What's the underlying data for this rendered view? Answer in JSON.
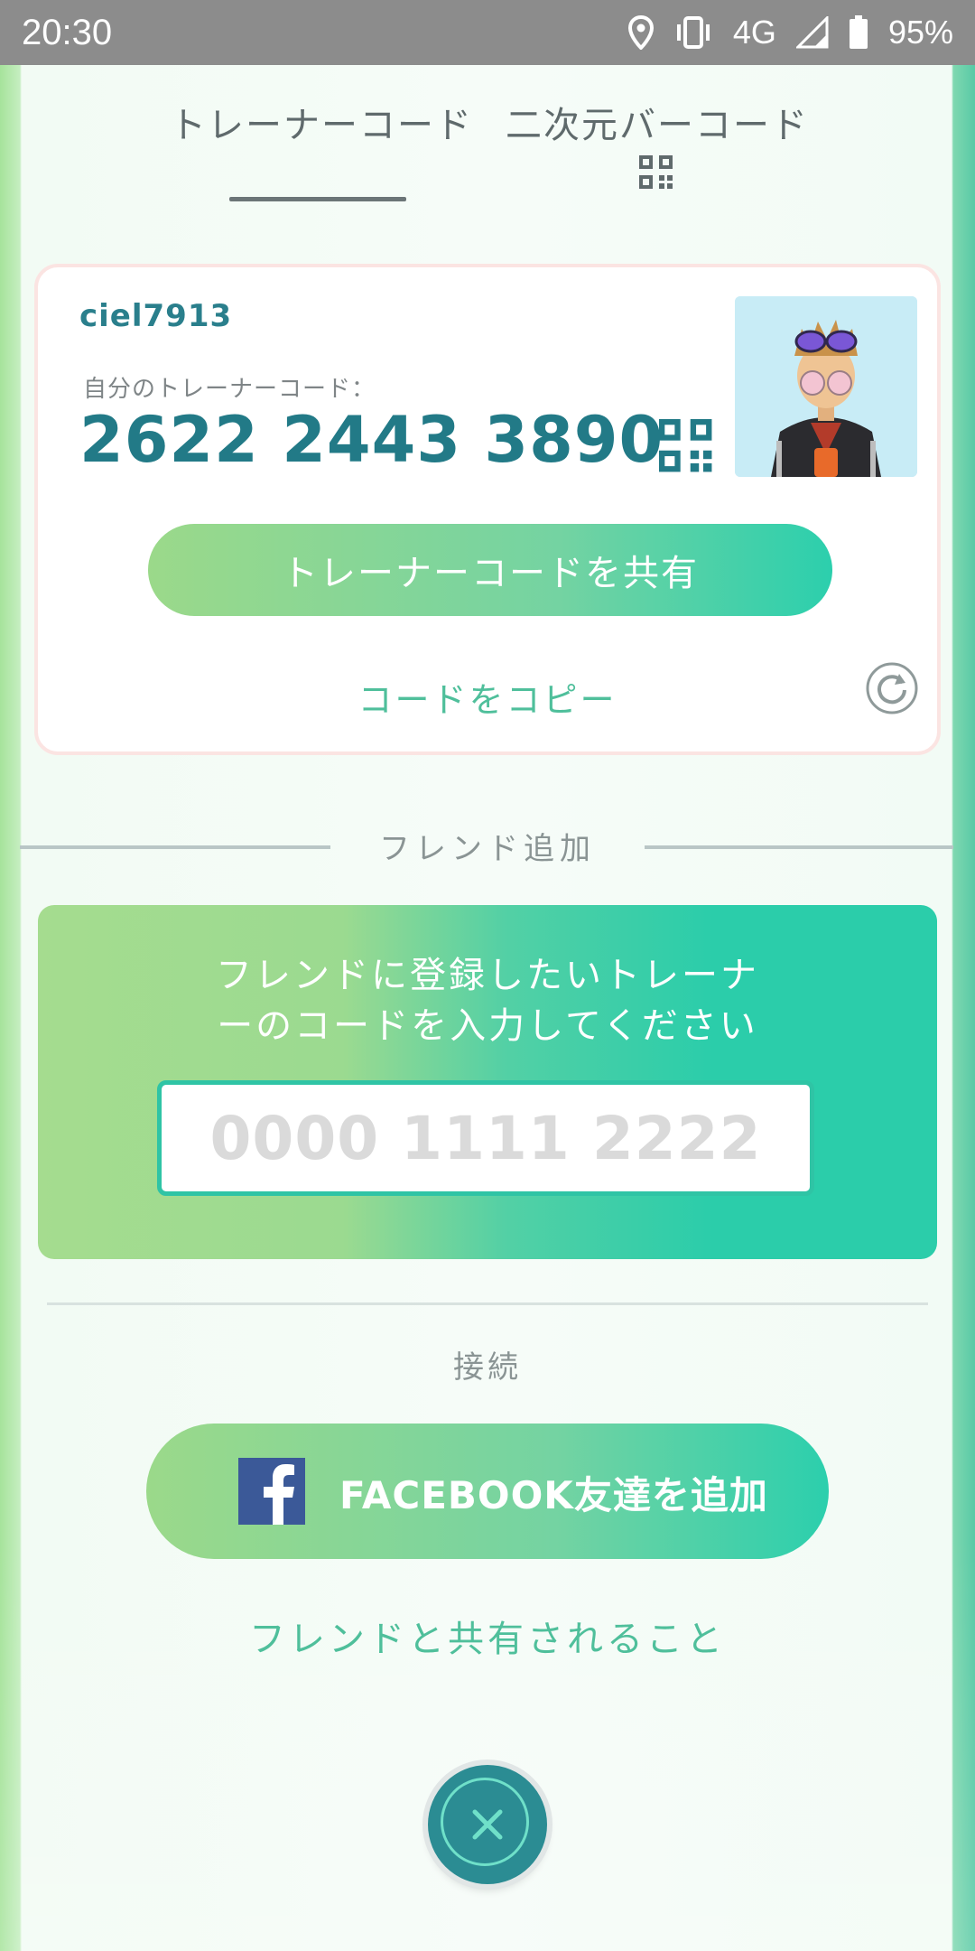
{
  "status_bar": {
    "time": "20:30",
    "network": "4G",
    "battery": "95%",
    "icons": [
      "location-icon",
      "vibrate-icon",
      "signal-icon",
      "battery-icon"
    ]
  },
  "tabs": [
    {
      "label": "トレーナーコード",
      "active": true
    },
    {
      "label": "二次元バーコード",
      "active": false,
      "icon": "qr-code-icon"
    }
  ],
  "trainer_card": {
    "username": "ciel7913",
    "code_label": "自分のトレーナーコード：",
    "code": "2622 2443 3890",
    "share_label": "トレーナーコードを共有",
    "copy_label": "コードをコピー"
  },
  "add_friend": {
    "section_title": "フレンド追加",
    "instruction_line1": "フレンドに登録したいトレーナ",
    "instruction_line2": "ーのコードを入力してください",
    "input_placeholder": "0000 1111 2222",
    "input_value": ""
  },
  "connect": {
    "section_title": "接続",
    "facebook_label": "FACEBOOK友達を追加",
    "shared_link": "フレンドと共有されること"
  },
  "colors": {
    "accent_green": "#2ccfad",
    "code_teal": "#227a87",
    "link_green": "#4fbf9b",
    "facebook_blue": "#3b5998"
  }
}
